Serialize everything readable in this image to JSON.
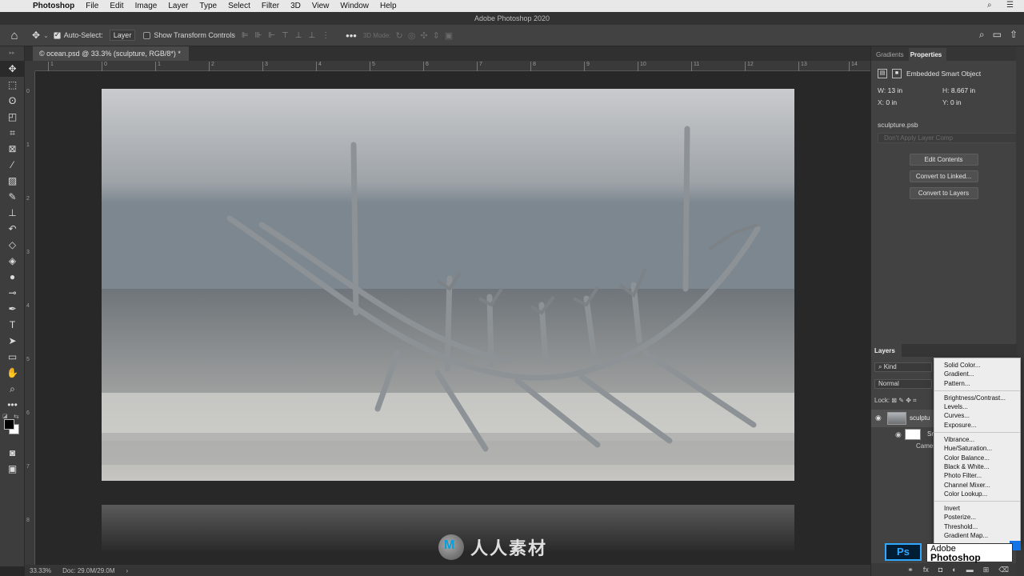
{
  "menubar": {
    "app": "Photoshop",
    "items": [
      "File",
      "Edit",
      "Image",
      "Layer",
      "Type",
      "Select",
      "Filter",
      "3D",
      "View",
      "Window",
      "Help"
    ]
  },
  "window": {
    "title": "Adobe Photoshop 2020"
  },
  "options": {
    "auto_select_label": "Auto-Select:",
    "auto_select_value": "Layer",
    "show_transform_label": "Show Transform Controls",
    "mode_3d_label": "3D Mode:"
  },
  "document": {
    "tab_label": "© ocean.psd @ 33.3% (sculpture, RGB/8*) *"
  },
  "rulers": {
    "h_ticks": [
      "1",
      "0",
      "1",
      "2",
      "3",
      "4",
      "5",
      "6",
      "7",
      "8",
      "9",
      "10",
      "11",
      "12",
      "13",
      "14"
    ],
    "v_ticks": [
      "0",
      "1",
      "2",
      "3",
      "4",
      "5",
      "6",
      "7",
      "8"
    ]
  },
  "status": {
    "zoom": "33.33%",
    "doc": "Doc: 29.0M/29.0M",
    "arrow": "›"
  },
  "properties": {
    "tabs": [
      "Gradients",
      "Properties"
    ],
    "active_tab": "Properties",
    "object_type": "Embedded Smart Object",
    "w_label": "W:",
    "w_value": "13 in",
    "h_label": "H:",
    "h_value": "8.667 in",
    "x_label": "X:",
    "x_value": "0 in",
    "y_label": "Y:",
    "y_value": "0 in",
    "filename": "sculpture.psb",
    "layer_comp_placeholder": "Don't Apply Layer Comp",
    "buttons": [
      "Edit Contents",
      "Convert to Linked...",
      "Convert to Layers"
    ]
  },
  "layers": {
    "tab": "Layers",
    "kind_label": "Kind",
    "blend_mode": "Normal",
    "lock_label": "Lock:",
    "layer_name": "sculptu",
    "sub_name": "Sm",
    "sub_label": "Camer"
  },
  "adjust_menu": {
    "groups": [
      [
        "Solid Color...",
        "Gradient...",
        "Pattern..."
      ],
      [
        "Brightness/Contrast...",
        "Levels...",
        "Curves...",
        "Exposure..."
      ],
      [
        "Vibrance...",
        "Hue/Saturation...",
        "Color Balance...",
        "Black & White...",
        "Photo Filter...",
        "Channel Mixer...",
        "Color Lookup..."
      ],
      [
        "Invert",
        "Posterize...",
        "Threshold...",
        "Gradient Map..."
      ]
    ]
  },
  "badges": {
    "ps": "Ps",
    "adobe_line1": "Adobe",
    "adobe_line2": "Photoshop"
  },
  "watermark": {
    "text": "人人素材"
  },
  "colors": {
    "panel_bg": "#424242",
    "canvas_bg": "#282828",
    "ps_blue": "#31a8ff",
    "menu_bg": "#ededed"
  }
}
